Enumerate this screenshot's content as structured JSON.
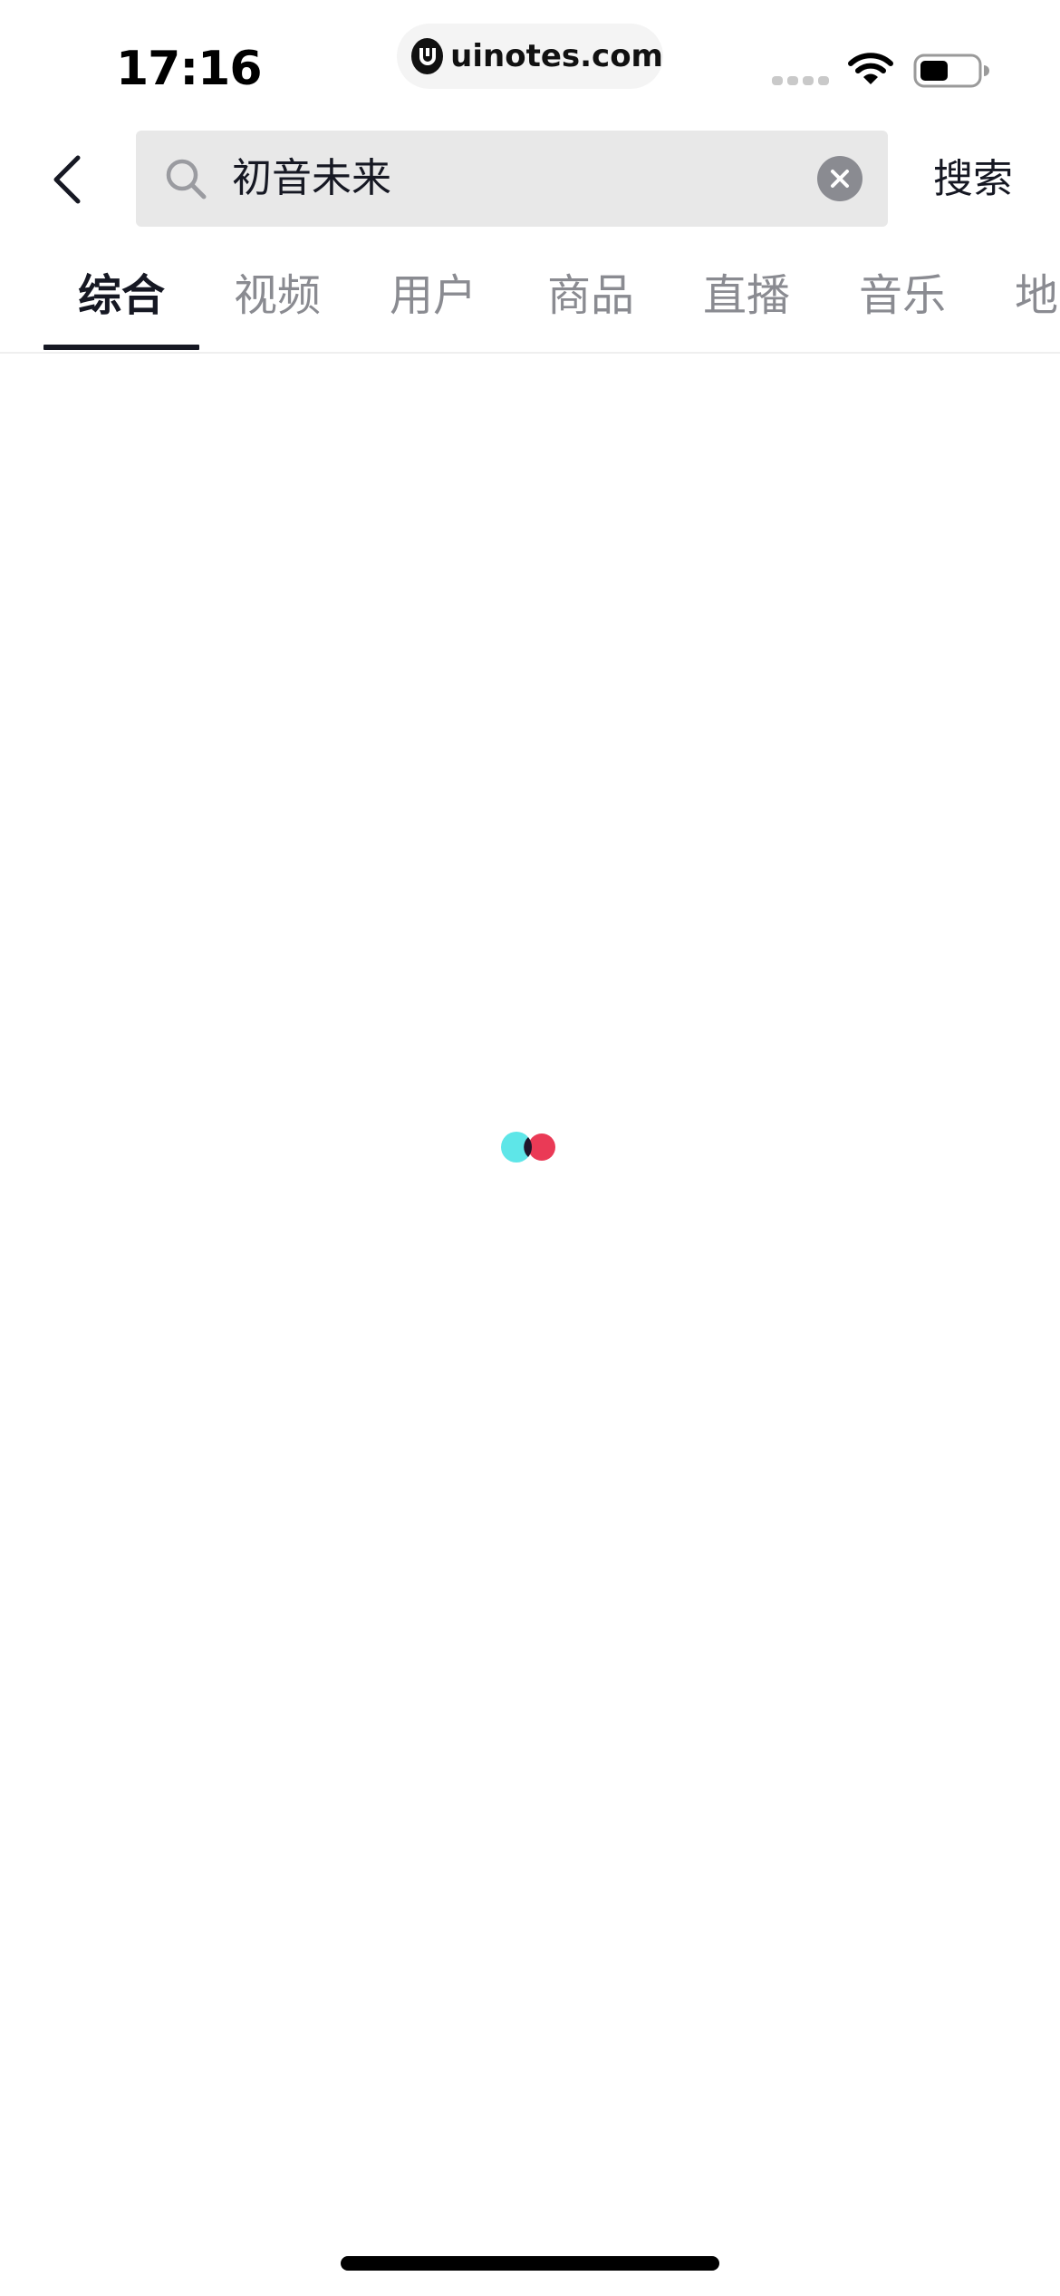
{
  "status_bar": {
    "time": "17:16",
    "url": "uinotes.com",
    "logo_icon": "uinotes-logo-icon",
    "wifi_icon": "wifi-icon",
    "battery_icon": "battery-icon",
    "battery_level": 0.5
  },
  "search": {
    "back_icon": "chevron-left-icon",
    "search_icon": "magnifier-icon",
    "query": "初音未来",
    "clear_icon": "close-circle-icon",
    "submit_label": "搜索"
  },
  "tabs": [
    {
      "label": "综合",
      "active": true
    },
    {
      "label": "视频",
      "active": false
    },
    {
      "label": "用户",
      "active": false
    },
    {
      "label": "商品",
      "active": false
    },
    {
      "label": "直播",
      "active": false
    },
    {
      "label": "音乐",
      "active": false
    },
    {
      "label": "地",
      "active": false
    }
  ],
  "loading": {
    "state": "loading",
    "colors": {
      "cyan": "#5ee6e8",
      "red": "#ea3a56",
      "overlap": "#20152a"
    }
  },
  "colors": {
    "primary_text": "#161823",
    "secondary_text": "#8a8b91",
    "search_bg": "#e8e8e8",
    "background": "#ffffff"
  }
}
